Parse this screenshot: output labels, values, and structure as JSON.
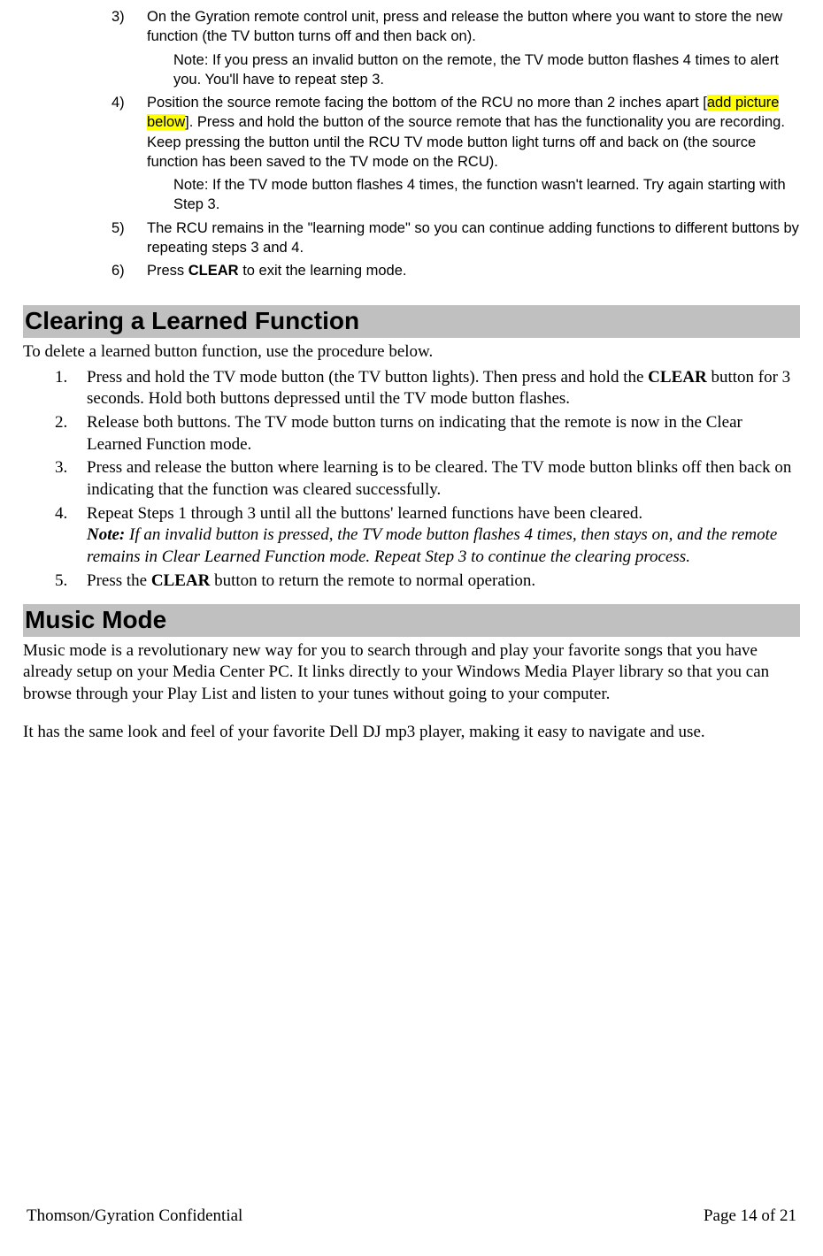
{
  "steps_top": [
    {
      "n": "3)",
      "text": "On the Gyration remote control unit, press and release the button where you want to store the new function (the TV button turns off and then back on).",
      "note": "Note: If you press an invalid button on the remote, the TV mode button flashes 4 times to alert you. You'll have to repeat step 3."
    },
    {
      "n": "4)",
      "pre": "Position the source remote facing the bottom of the RCU no more than 2 inches apart [",
      "hl": "add picture below",
      "post": "]. Press and hold the button of the source remote that has the functionality you are recording. Keep pressing the button until the RCU TV mode button light turns off and back on (the source function has been saved to the TV mode on the RCU).",
      "note": "Note: If the TV mode button flashes 4 times, the function wasn't learned. Try again starting with Step 3."
    },
    {
      "n": "5)",
      "text": "The RCU remains in the \"learning mode\" so you can continue adding functions to different buttons by repeating steps 3 and 4."
    },
    {
      "n": "6)",
      "pre": "Press ",
      "bold": "CLEAR",
      "post": " to exit the learning mode."
    }
  ],
  "section1": {
    "title": "Clearing a Learned Function",
    "intro": "To delete a learned button function, use the procedure below.",
    "items": [
      {
        "n": "1.",
        "seg": [
          {
            "t": "Press and hold the TV mode button (the TV button lights).  Then press and hold the "
          },
          {
            "t": "CLEAR",
            "b": true
          },
          {
            "t": " button for 3 seconds.  Hold both buttons depressed until the TV mode button flashes."
          }
        ]
      },
      {
        "n": "2.",
        "seg": [
          {
            "t": "Release both buttons.  The TV mode button turns on indicating that the remote is now in the Clear Learned Function mode."
          }
        ]
      },
      {
        "n": "3.",
        "seg": [
          {
            "t": "Press and release the button where learning is to be cleared.  The TV mode button blinks off then back on indicating that the function was cleared successfully."
          }
        ]
      },
      {
        "n": "4.",
        "seg": [
          {
            "t": "Repeat Steps 1 through 3 until all the buttons' learned functions have been cleared."
          }
        ],
        "note_prefix": "Note:",
        "note_body": " If an invalid button is pressed, the TV mode button flashes 4 times, then stays on, and the remote remains in Clear Learned Function mode. Repeat Step 3 to continue the clearing process."
      },
      {
        "n": "5.",
        "seg": [
          {
            "t": "Press the "
          },
          {
            "t": "CLEAR",
            "b": true
          },
          {
            "t": " button to return the remote to normal operation."
          }
        ]
      }
    ]
  },
  "section2": {
    "title": "Music Mode",
    "p1": "Music mode is a revolutionary new way for you to search through and play your favorite songs that you have already setup on your Media Center PC.  It links directly to your Windows Media Player library so that you can browse through your Play List and listen to your tunes without going to your computer.",
    "p2": "It has the same look and feel of your favorite Dell DJ mp3 player, making it easy to navigate and use."
  },
  "footer": {
    "left": "Thomson/Gyration Confidential",
    "right": "Page 14 of 21"
  }
}
